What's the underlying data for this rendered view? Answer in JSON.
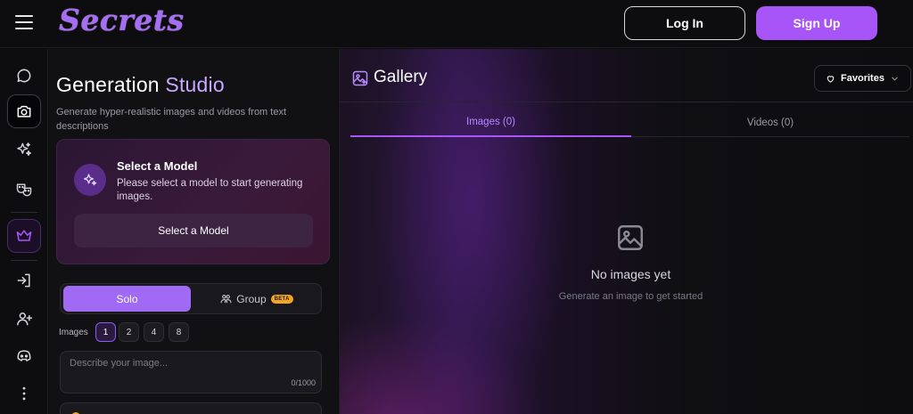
{
  "header": {
    "logo_text": "Secrets",
    "login_label": "Log In",
    "signup_label": "Sign Up"
  },
  "rail": {
    "items": [
      {
        "name": "chat",
        "icon": "chat-bubble-icon"
      },
      {
        "name": "generation-studio",
        "icon": "camera-icon",
        "active": true
      },
      {
        "name": "sparkles",
        "icon": "sparkles-icon"
      },
      {
        "name": "roleplay",
        "icon": "masks-icon"
      },
      {
        "name": "premium",
        "icon": "crown-icon"
      },
      {
        "name": "login",
        "icon": "sign-in-icon"
      },
      {
        "name": "register",
        "icon": "user-plus-icon"
      },
      {
        "name": "discord",
        "icon": "discord-icon"
      },
      {
        "name": "more",
        "icon": "more-vertical-icon"
      }
    ],
    "accent_color": "#a855f7"
  },
  "studio": {
    "title_main": "Generation",
    "title_accent": "Studio",
    "subtitle": "Generate hyper-realistic images and videos from text descriptions",
    "model_card": {
      "title": "Select a Model",
      "description": "Please select a model to start generating images.",
      "button_label": "Select a Model"
    },
    "mode": {
      "solo_label": "Solo",
      "group_label": "Group",
      "group_badge": "BETA"
    },
    "images_label": "Images",
    "image_counts": [
      "1",
      "2",
      "4",
      "8"
    ],
    "selected_count": "1",
    "prompt": {
      "placeholder": "Describe your image...",
      "value": "",
      "counter": "0/1000"
    }
  },
  "gallery": {
    "title": "Gallery",
    "favorites_label": "Favorites",
    "tabs": [
      {
        "label": "Images (0)",
        "active": true
      },
      {
        "label": "Videos (0)",
        "active": false
      }
    ],
    "empty_title": "No images yet",
    "empty_subtitle": "Generate an image to get started"
  }
}
